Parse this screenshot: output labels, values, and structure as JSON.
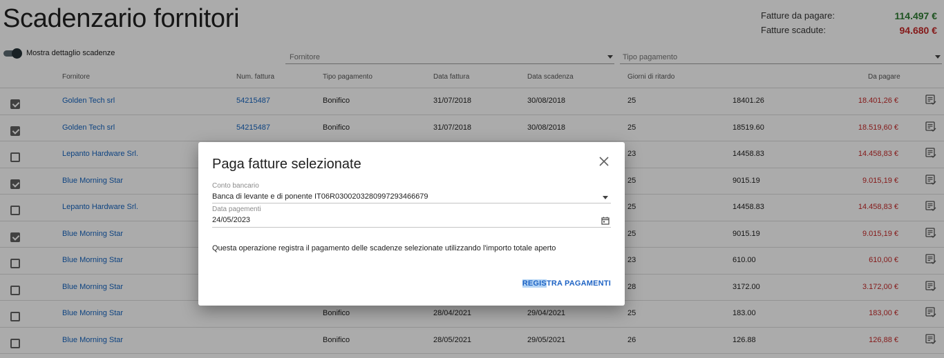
{
  "page": {
    "title": "Scadenzario fornitori"
  },
  "summary": {
    "to_pay_label": "Fatture da pagare:",
    "to_pay_value": "114.497 €",
    "overdue_label": "Fatture scadute:",
    "overdue_value": "94.680 €"
  },
  "toggle": {
    "label": "Mostra dettaglio scadenze",
    "on": true
  },
  "filters": {
    "fornitore_placeholder": "Fornitore",
    "tipo_pagamento_placeholder": "Tipo pagamento"
  },
  "table": {
    "headers": {
      "fornitore": "Fornitore",
      "num_fattura": "Num. fattura",
      "tipo_pagamento": "Tipo pagamento",
      "data_fattura": "Data fattura",
      "data_scadenza": "Data scadenza",
      "giorni_ritardo": "Giorni di ritardo",
      "da_pagare": "Da pagare"
    },
    "rows": [
      {
        "checked": true,
        "fornitore": "Golden Tech srl",
        "num": "54215487",
        "tipo": "Bonifico",
        "data_fattura": "31/07/2018",
        "data_scadenza": "30/08/2018",
        "giorni": "25",
        "importo": "18401.26",
        "da_pagare": "18.401,26 €"
      },
      {
        "checked": true,
        "fornitore": "Golden Tech srl",
        "num": "54215487",
        "tipo": "Bonifico",
        "data_fattura": "31/07/2018",
        "data_scadenza": "30/08/2018",
        "giorni": "25",
        "importo": "18519.60",
        "da_pagare": "18.519,60 €"
      },
      {
        "checked": false,
        "fornitore": "Lepanto Hardware Srl.",
        "num": "",
        "tipo": "",
        "data_fattura": "",
        "data_scadenza": "",
        "giorni": "23",
        "importo": "14458.83",
        "da_pagare": "14.458,83 €"
      },
      {
        "checked": true,
        "fornitore": "Blue Morning Star",
        "num": "",
        "tipo": "",
        "data_fattura": "",
        "data_scadenza": "",
        "giorni": "25",
        "importo": "9015.19",
        "da_pagare": "9.015,19 €"
      },
      {
        "checked": false,
        "fornitore": "Lepanto Hardware Srl.",
        "num": "",
        "tipo": "",
        "data_fattura": "",
        "data_scadenza": "",
        "giorni": "25",
        "importo": "14458.83",
        "da_pagare": "14.458,83 €"
      },
      {
        "checked": true,
        "fornitore": "Blue Morning Star",
        "num": "",
        "tipo": "",
        "data_fattura": "",
        "data_scadenza": "",
        "giorni": "25",
        "importo": "9015.19",
        "da_pagare": "9.015,19 €"
      },
      {
        "checked": false,
        "fornitore": "Blue Morning Star",
        "num": "",
        "tipo": "",
        "data_fattura": "",
        "data_scadenza": "",
        "giorni": "23",
        "importo": "610.00",
        "da_pagare": "610,00 €"
      },
      {
        "checked": false,
        "fornitore": "Blue Morning Star",
        "num": "",
        "tipo": "",
        "data_fattura": "",
        "data_scadenza": "",
        "giorni": "28",
        "importo": "3172.00",
        "da_pagare": "3.172,00 €"
      },
      {
        "checked": false,
        "fornitore": "Blue Morning Star",
        "num": "",
        "tipo": "Bonifico",
        "data_fattura": "28/04/2021",
        "data_scadenza": "29/04/2021",
        "giorni": "25",
        "importo": "183.00",
        "da_pagare": "183,00 €"
      },
      {
        "checked": false,
        "fornitore": "Blue Morning Star",
        "num": "",
        "tipo": "Bonifico",
        "data_fattura": "28/05/2021",
        "data_scadenza": "29/05/2021",
        "giorni": "26",
        "importo": "126.88",
        "da_pagare": "126,88 €"
      }
    ]
  },
  "dialog": {
    "title": "Paga fatture selezionate",
    "conto_label": "Conto bancario",
    "conto_value": "Banca di levante e di ponente IT06R0300203280997293466679",
    "data_label": "Data pagementi",
    "data_value": "24/05/2023",
    "message": "Questa operazione registra il pagamento delle scadenze selezionate utilizzando l'importo totale aperto",
    "button_highlight": "REGIS",
    "button_rest": "TRA PAGAMENTI"
  },
  "colors": {
    "accent": "#1565c0",
    "overdue": "#c62828",
    "positive": "#2e7d32"
  },
  "icons": {
    "row_action": "list-check-icon",
    "close": "close-icon",
    "calendar": "calendar-icon",
    "dropdown": "dropdown-arrow-icon"
  }
}
